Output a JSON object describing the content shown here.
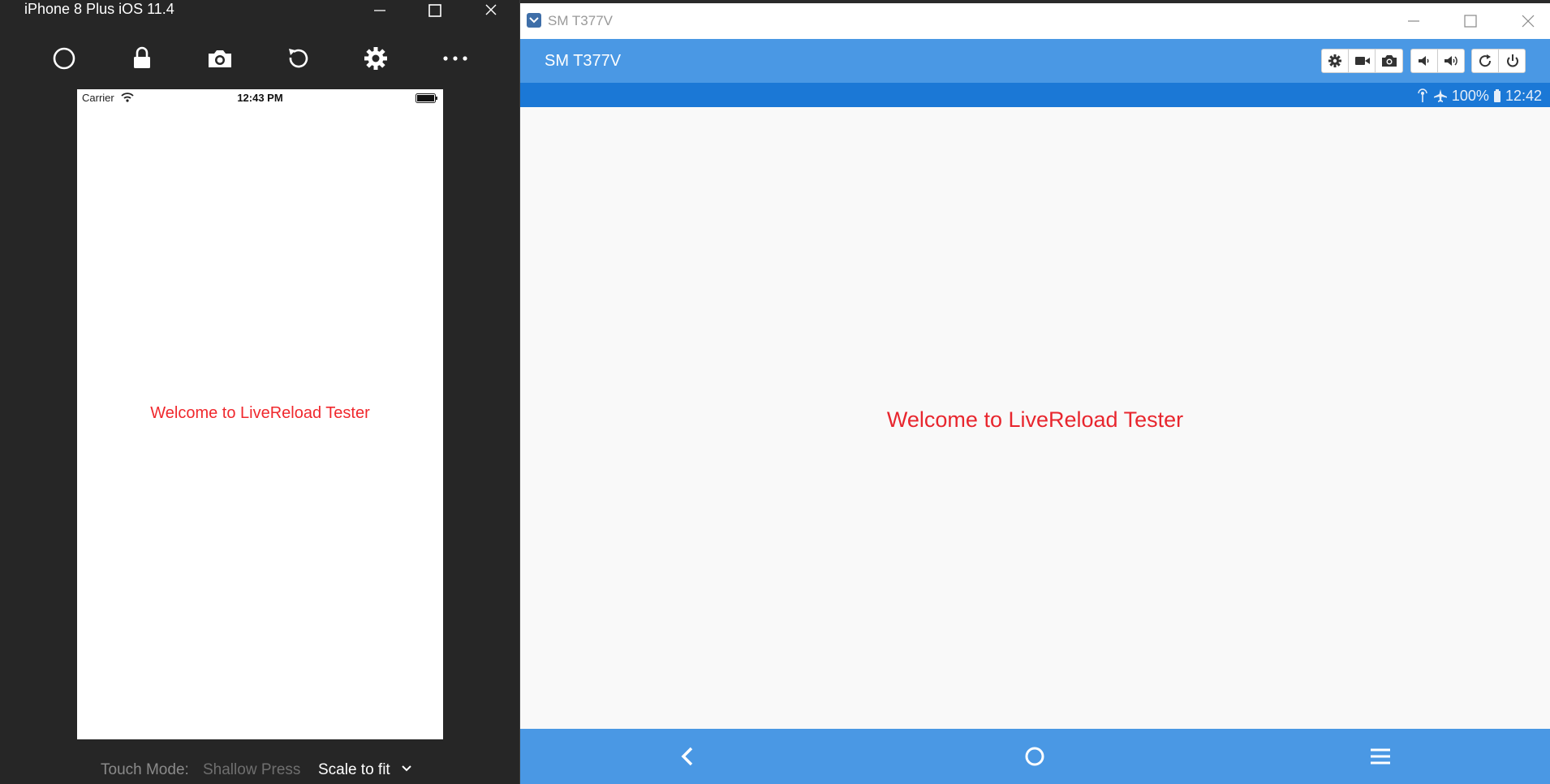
{
  "ios": {
    "window_title": "iPhone 8 Plus iOS 11.4",
    "toolbar_icons": [
      "home-circle-icon",
      "lock-icon",
      "camera-icon",
      "rotate-icon",
      "gear-icon",
      "more-icon"
    ],
    "status": {
      "carrier": "Carrier",
      "time": "12:43 PM"
    },
    "welcome_text": "Welcome to LiveReload Tester",
    "footer": {
      "touch_mode_label": "Touch Mode:",
      "touch_mode_value": "Shallow Press",
      "scale_label": "Scale to fit"
    }
  },
  "android": {
    "window_title": "SM T377V",
    "device_name": "SM T377V",
    "control_icons": [
      "gear-icon",
      "video-camera-icon",
      "camera-icon",
      "volume-down-icon",
      "volume-up-icon",
      "rotate-icon",
      "power-icon"
    ],
    "status": {
      "battery": "100%",
      "time": "12:42"
    },
    "welcome_text": "Welcome to LiveReload Tester",
    "nav_icons": [
      "back-icon",
      "home-icon",
      "menu-icon"
    ]
  },
  "colors": {
    "accent_blue": "#4a98e4",
    "status_blue": "#1b78d6",
    "welcome_red": "#e8262e",
    "ios_frame": "#262626"
  }
}
